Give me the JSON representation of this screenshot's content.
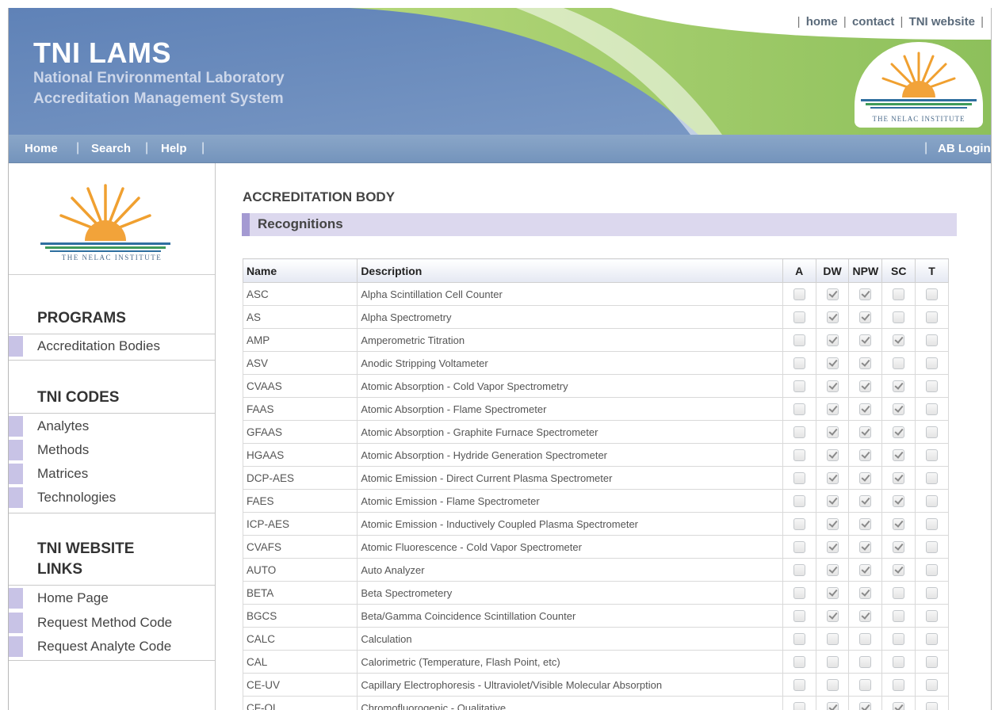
{
  "header": {
    "title": "TNI LAMS",
    "subtitle_line1": "National Environmental Laboratory",
    "subtitle_line2": "Accreditation Management System",
    "badge_text": "THE NELAC INSTITUTE",
    "top_links": [
      "home",
      "contact",
      "TNI website"
    ]
  },
  "navbar": {
    "items": [
      "Home",
      "Search",
      "Help"
    ],
    "login": "AB Login"
  },
  "sidebar": {
    "logo_text": "THE NELAC INSTITUTE",
    "sections": [
      {
        "title": "PROGRAMS",
        "items": [
          "Accreditation Bodies"
        ]
      },
      {
        "title": "TNI CODES",
        "items": [
          "Analytes",
          "Methods",
          "Matrices",
          "Technologies"
        ]
      },
      {
        "title_line1": "TNI WEBSITE",
        "title_line2": "LINKS",
        "items": [
          "Home Page",
          "Request Method Code",
          "Request Analyte Code"
        ]
      }
    ]
  },
  "main": {
    "page_title": "ACCREDITATION BODY",
    "section_title": "Recognitions",
    "columns": [
      "Name",
      "Description",
      "A",
      "DW",
      "NPW",
      "SC",
      "T"
    ],
    "rows": [
      {
        "name": "ASC",
        "desc": "Alpha Scintillation Cell Counter",
        "checks": [
          false,
          true,
          true,
          false,
          false
        ]
      },
      {
        "name": "AS",
        "desc": "Alpha Spectrometry",
        "checks": [
          false,
          true,
          true,
          false,
          false
        ]
      },
      {
        "name": "AMP",
        "desc": "Amperometric Titration",
        "checks": [
          false,
          true,
          true,
          true,
          false
        ]
      },
      {
        "name": "ASV",
        "desc": "Anodic Stripping Voltameter",
        "checks": [
          false,
          true,
          true,
          false,
          false
        ]
      },
      {
        "name": "CVAAS",
        "desc": "Atomic Absorption - Cold Vapor Spectrometry",
        "checks": [
          false,
          true,
          true,
          true,
          false
        ]
      },
      {
        "name": "FAAS",
        "desc": "Atomic Absorption - Flame Spectrometer",
        "checks": [
          false,
          true,
          true,
          true,
          false
        ]
      },
      {
        "name": "GFAAS",
        "desc": "Atomic Absorption - Graphite Furnace Spectrometer",
        "checks": [
          false,
          true,
          true,
          true,
          false
        ]
      },
      {
        "name": "HGAAS",
        "desc": "Atomic Absorption - Hydride Generation Spectrometer",
        "checks": [
          false,
          true,
          true,
          true,
          false
        ]
      },
      {
        "name": "DCP-AES",
        "desc": "Atomic Emission - Direct Current Plasma Spectrometer",
        "checks": [
          false,
          true,
          true,
          true,
          false
        ]
      },
      {
        "name": "FAES",
        "desc": "Atomic Emission - Flame Spectrometer",
        "checks": [
          false,
          true,
          true,
          true,
          false
        ]
      },
      {
        "name": "ICP-AES",
        "desc": "Atomic Emission - Inductively Coupled Plasma Spectrometer",
        "checks": [
          false,
          true,
          true,
          true,
          false
        ]
      },
      {
        "name": "CVAFS",
        "desc": "Atomic Fluorescence - Cold Vapor Spectrometer",
        "checks": [
          false,
          true,
          true,
          true,
          false
        ]
      },
      {
        "name": "AUTO",
        "desc": "Auto Analyzer",
        "checks": [
          false,
          true,
          true,
          true,
          false
        ]
      },
      {
        "name": "BETA",
        "desc": "Beta Spectrometery",
        "checks": [
          false,
          true,
          true,
          false,
          false
        ]
      },
      {
        "name": "BGCS",
        "desc": "Beta/Gamma Coincidence Scintillation Counter",
        "checks": [
          false,
          true,
          true,
          false,
          false
        ]
      },
      {
        "name": "CALC",
        "desc": "Calculation",
        "checks": [
          false,
          false,
          false,
          false,
          false
        ]
      },
      {
        "name": "CAL",
        "desc": "Calorimetric (Temperature, Flash Point, etc)",
        "checks": [
          false,
          false,
          false,
          false,
          false
        ]
      },
      {
        "name": "CE-UV",
        "desc": "Capillary Electrophoresis - Ultraviolet/Visible Molecular Absorption",
        "checks": [
          false,
          false,
          false,
          false,
          false
        ]
      },
      {
        "name": "CF-QL",
        "desc": "Chromofluorogenic - Qualitative",
        "checks": [
          false,
          true,
          true,
          true,
          false
        ]
      }
    ]
  }
}
